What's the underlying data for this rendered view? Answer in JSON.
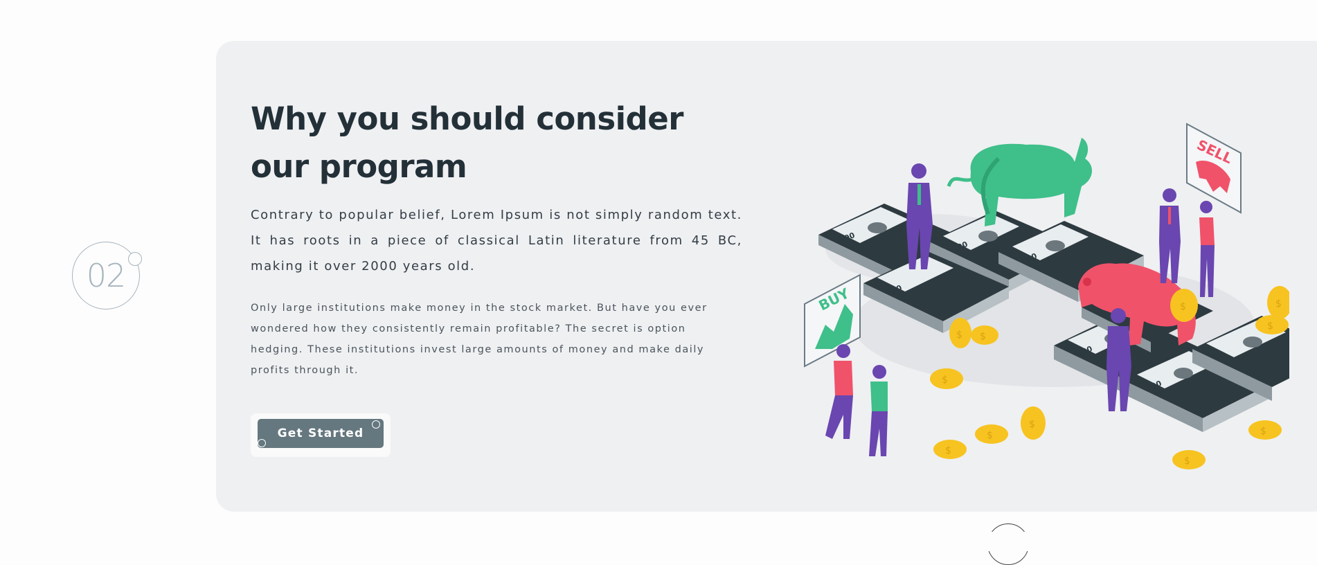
{
  "section": {
    "step_number": "02",
    "heading_line1": "Why you should consider",
    "heading_line2": "our program",
    "lead_text": "Contrary to popular belief, Lorem Ipsum is not simply random text. It has roots in a piece of classical Latin literature from 45 BC, making it over 2000 years old.",
    "body_text": "Only large institutions make money in the stock market. But have you ever wondered how they consistently remain profitable? The secret is option hedging. These institutions invest large amounts of money and make daily profits through it.",
    "cta_label": "Get Started"
  },
  "illustration": {
    "sell_sign": "SELL",
    "buy_sign": "BUY",
    "bill_label": "100",
    "coin_symbol": "$"
  },
  "colors": {
    "card_bg": "#eff0f2",
    "heading": "#233038",
    "button": "#65777f",
    "bull": "#3fbf8a",
    "bear": "#f0526a",
    "people": "#6a46b0",
    "coin": "#f7c320"
  }
}
